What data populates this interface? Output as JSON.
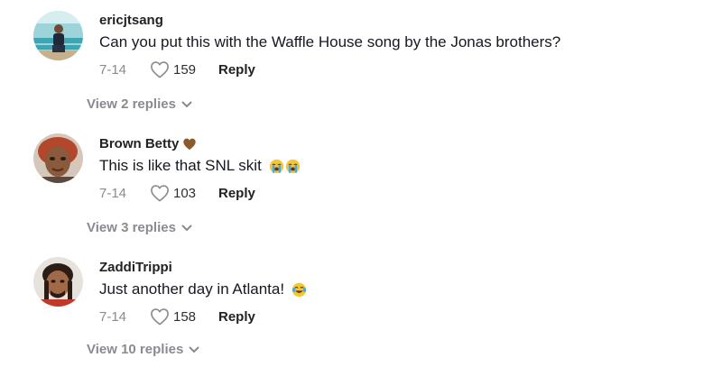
{
  "comments": [
    {
      "username": "ericjtsang",
      "text": "Can you put this with the Waffle House song by the Jonas brothers?",
      "date": "7-14",
      "likes": "159",
      "reply_label": "Reply",
      "view_replies": "View 2 replies",
      "avatar": "bench-photo"
    },
    {
      "username": "Brown Betty",
      "username_badge": "brown-heart-icon",
      "text": "This is like that SNL skit",
      "text_emojis": [
        "loudly-crying-face-icon",
        "loudly-crying-face-icon"
      ],
      "date": "7-14",
      "likes": "103",
      "reply_label": "Reply",
      "view_replies": "View 3 replies",
      "avatar": "portrait-photo"
    },
    {
      "username": "ZaddiTrippi",
      "text": "Just another day in Atlanta!",
      "text_emojis": [
        "tears-of-joy-icon"
      ],
      "date": "7-14",
      "likes": "158",
      "reply_label": "Reply",
      "view_replies": "View 10 replies",
      "avatar": "portrait-photo"
    }
  ],
  "colors": {
    "meta_gray": "#8a8b91",
    "name": "#222222",
    "text": "#161823",
    "heart_brown": "#8b5a2b",
    "emoji_yellow": "#f7c531",
    "tear_blue": "#4aa8e6"
  }
}
